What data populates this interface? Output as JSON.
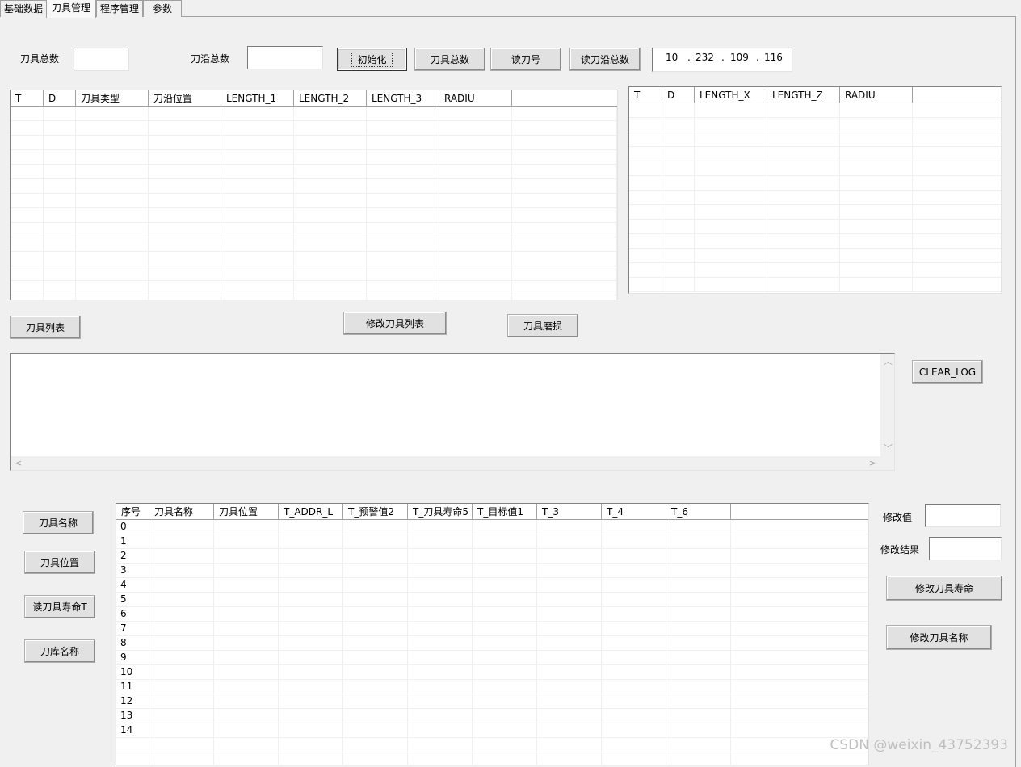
{
  "tabs": [
    {
      "label": "基础数据"
    },
    {
      "label": "刀具管理"
    },
    {
      "label": "程序管理"
    },
    {
      "label": "参数"
    }
  ],
  "top": {
    "tool_total_label": "刀具总数",
    "edge_total_label": "刀沿总数",
    "tool_total_value": "",
    "edge_total_value": "",
    "init_button": "初始化",
    "tool_total_button": "刀具总数",
    "read_tool_no_button": "读刀号",
    "read_edge_total_button": "读刀沿总数",
    "ip": [
      "10",
      "232",
      "109",
      "116"
    ],
    "ip_dot": "."
  },
  "left_table": {
    "columns": [
      "T",
      "D",
      "刀具类型",
      "刀沿位置",
      "LENGTH_1",
      "LENGTH_2",
      "LENGTH_3",
      "RADIU",
      ""
    ]
  },
  "right_table": {
    "columns": [
      "T",
      "D",
      "LENGTH_X",
      "LENGTH_Z",
      "RADIU",
      ""
    ]
  },
  "mid_buttons": {
    "tool_list": "刀具列表",
    "modify_tool_list": "修改刀具列表",
    "tool_wear": "刀具磨损",
    "clear_log": "CLEAR_LOG"
  },
  "log": {
    "text": ""
  },
  "bottom_left_buttons": {
    "tool_name": "刀具名称",
    "tool_position": "刀具位置",
    "read_tool_life": "读刀具寿命T",
    "magazine_name": "刀库名称"
  },
  "bottom_table": {
    "columns": [
      "序号",
      "刀具名称",
      "刀具位置",
      "T_ADDR_L",
      "T_预警值2",
      "T_刀具寿命5",
      "T_目标值1",
      "T_3",
      "T_4",
      "T_6",
      ""
    ],
    "rows": [
      "0",
      "1",
      "2",
      "3",
      "4",
      "5",
      "6",
      "7",
      "8",
      "9",
      "10",
      "11",
      "12",
      "13",
      "14"
    ]
  },
  "right_panel": {
    "modify_value_label": "修改值",
    "modify_result_label": "修改结果",
    "modify_value": "",
    "modify_result": "",
    "modify_life_button": "修改刀具寿命",
    "modify_name_button": "修改刀具名称"
  },
  "watermark": "CSDN @weixin_43752393"
}
